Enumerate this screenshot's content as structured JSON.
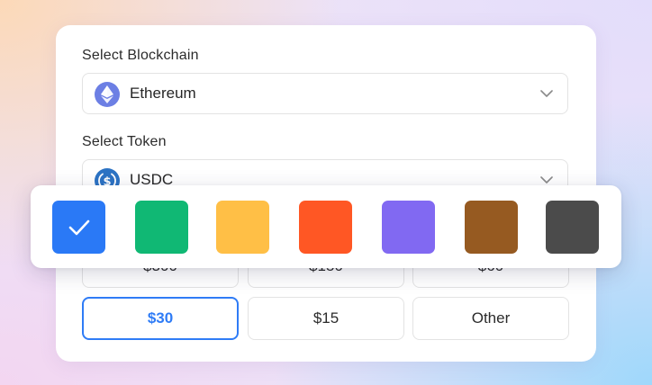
{
  "blockchain": {
    "label": "Select Blockchain",
    "value": "Ethereum",
    "icon": "ethereum-icon",
    "icon_color": "#6c7fe4"
  },
  "token": {
    "label": "Select Token",
    "value": "USDC",
    "icon": "usdc-icon",
    "icon_color": "#2c73c4"
  },
  "amounts": {
    "row1": [
      "$300",
      "$150",
      "$60"
    ],
    "row2": [
      "$30",
      "$15",
      "Other"
    ],
    "selected": "$30"
  },
  "color_picker": {
    "selected_index": 0,
    "colors": [
      "#2a79f6",
      "#10b874",
      "#ffbf46",
      "#ff5724",
      "#8169f2",
      "#965a21",
      "#4b4b4b"
    ]
  }
}
